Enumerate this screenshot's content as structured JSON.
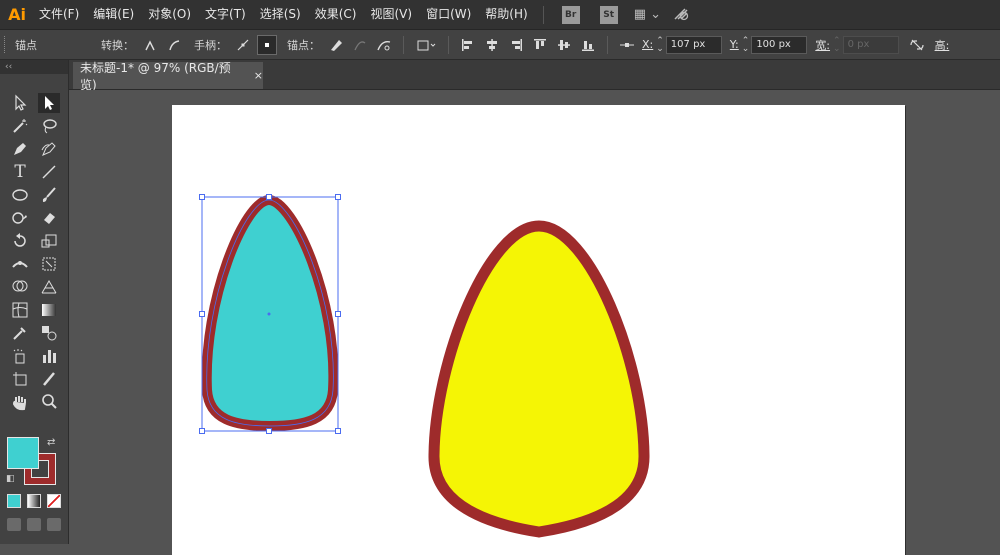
{
  "app": {
    "logo": "Ai"
  },
  "menu": {
    "items": [
      "文件(F)",
      "编辑(E)",
      "对象(O)",
      "文字(T)",
      "选择(S)",
      "效果(C)",
      "视图(V)",
      "窗口(W)",
      "帮助(H)"
    ],
    "bridge_label": "Br",
    "stock_label": "St"
  },
  "control": {
    "anchor_label": "锚点",
    "convert_label": "转换：",
    "handles_label": "手柄：",
    "anchors_label": "锚点：",
    "x_label": "X:",
    "x_value": "107 px",
    "y_label": "Y:",
    "y_value": "100 px",
    "width_label": "宽:",
    "width_value": "0 px",
    "height_label": "高:"
  },
  "document": {
    "tab_title": "未标题-1* @ 97% (RGB/预览)",
    "close_glyph": "×"
  },
  "colors": {
    "fill": "#3fd0d0",
    "stroke": "#9e2b2b",
    "egg_yellow": "#f5f505",
    "selection": "#4b6cf0"
  },
  "toolbar": {
    "header": "‹‹",
    "tools": [
      "selection-tool",
      "direct-selection-tool",
      "magic-wand-tool",
      "lasso-tool",
      "pen-tool",
      "curvature-tool",
      "type-tool",
      "line-segment-tool",
      "ellipse-tool",
      "paintbrush-tool",
      "shaper-tool",
      "eraser-tool",
      "rotate-tool",
      "scale-tool",
      "width-tool",
      "free-transform-tool",
      "shape-builder-tool",
      "perspective-grid-tool",
      "mesh-tool",
      "gradient-tool",
      "eyedropper-tool",
      "blend-tool",
      "symbol-sprayer-tool",
      "column-graph-tool",
      "artboard-tool",
      "slice-tool",
      "hand-tool",
      "zoom-tool"
    ]
  }
}
